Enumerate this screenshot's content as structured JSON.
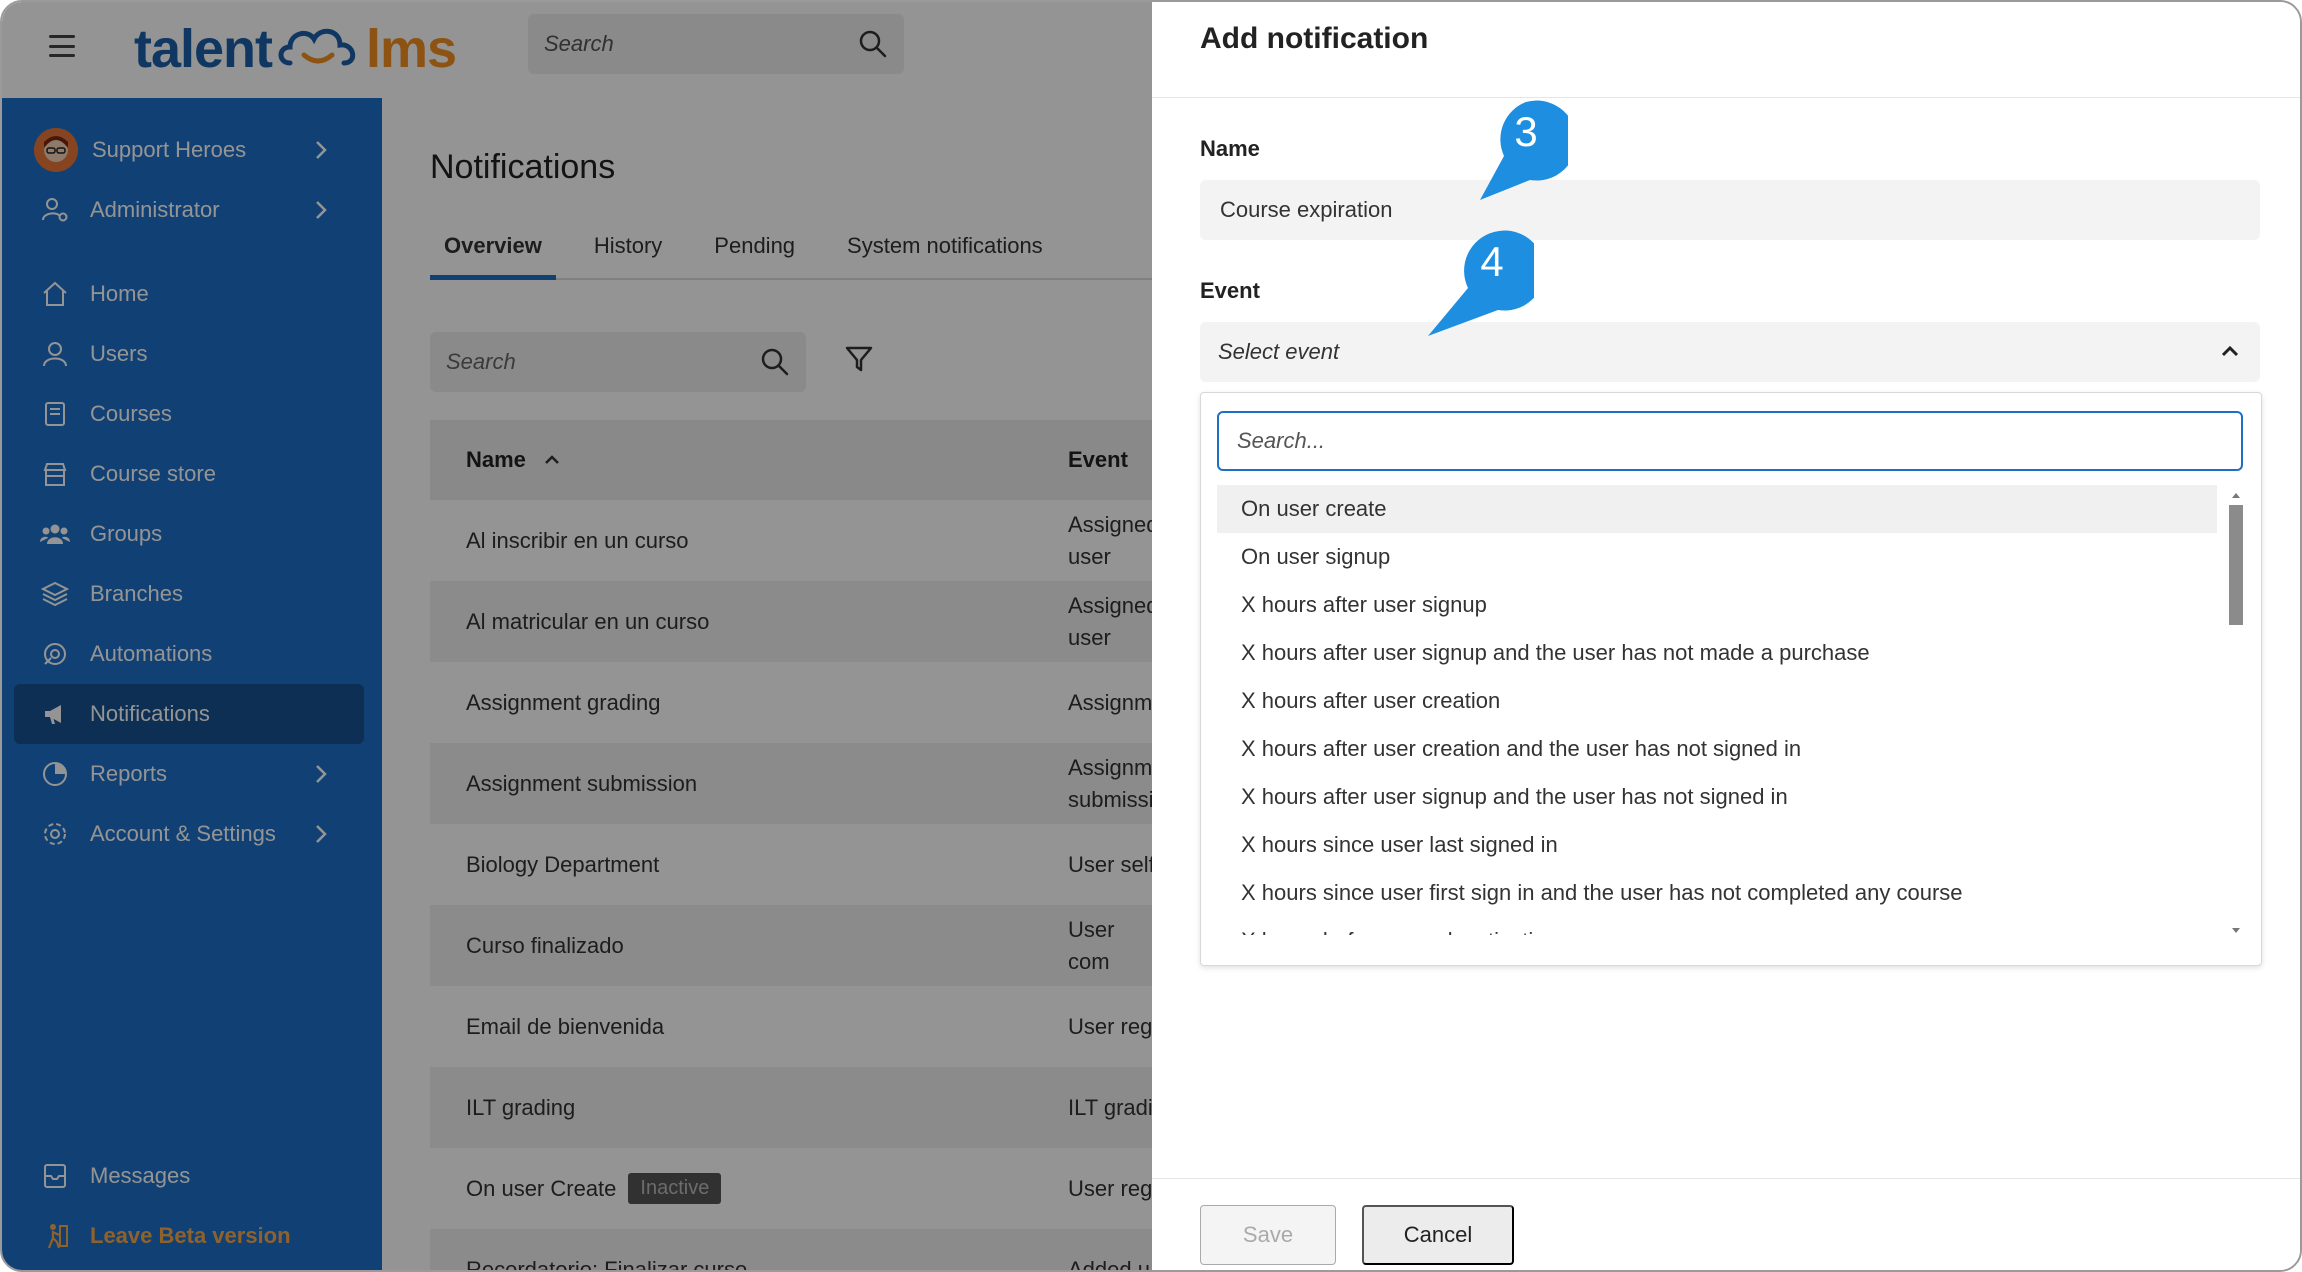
{
  "topbar": {
    "logo_left": "talent",
    "logo_right": "lms",
    "search_placeholder": "Search"
  },
  "sidebar": {
    "account": {
      "label": "Support Heroes"
    },
    "role": {
      "label": "Administrator"
    },
    "items": [
      {
        "label": "Home",
        "icon": "home-icon"
      },
      {
        "label": "Users",
        "icon": "user-icon"
      },
      {
        "label": "Courses",
        "icon": "book-icon"
      },
      {
        "label": "Course store",
        "icon": "store-icon"
      },
      {
        "label": "Groups",
        "icon": "group-icon"
      },
      {
        "label": "Branches",
        "icon": "layers-icon"
      },
      {
        "label": "Automations",
        "icon": "automation-icon"
      },
      {
        "label": "Notifications",
        "icon": "megaphone-icon",
        "active": true
      },
      {
        "label": "Reports",
        "icon": "pie-chart-icon"
      },
      {
        "label": "Account & Settings",
        "icon": "gear-icon"
      }
    ],
    "messages": {
      "label": "Messages"
    },
    "beta": {
      "label": "Leave Beta version"
    }
  },
  "main": {
    "title": "Notifications",
    "tabs": [
      {
        "label": "Overview",
        "active": true
      },
      {
        "label": "History"
      },
      {
        "label": "Pending"
      },
      {
        "label": "System notifications"
      }
    ],
    "search_placeholder": "Search",
    "table": {
      "columns": [
        "Name",
        "Event"
      ],
      "rows": [
        {
          "name": "Al inscribir en un curso",
          "event": "Assigned\nuser"
        },
        {
          "name": "Al matricular en un curso",
          "event": "Assigned\nuser"
        },
        {
          "name": "Assignment grading",
          "event": "Assignm"
        },
        {
          "name": "Assignment submission",
          "event": "Assignm\nsubmissi"
        },
        {
          "name": "Biology Department",
          "event": "User self"
        },
        {
          "name": "Curso finalizado",
          "event": "User com"
        },
        {
          "name": "Email de bienvenida",
          "event": "User reg"
        },
        {
          "name": "ILT grading",
          "event": "ILT gradi"
        },
        {
          "name": "On user Create",
          "event": "User reg",
          "badge": "Inactive"
        },
        {
          "name": "Recordatorio: Finalizar curso",
          "event": "Added u"
        }
      ]
    }
  },
  "drawer": {
    "title": "Add notification",
    "name_label": "Name",
    "name_value": "Course expiration",
    "event_label": "Event",
    "event_placeholder": "Select event",
    "dropdown": {
      "search_placeholder": "Search...",
      "options": [
        "On user create",
        "On user signup",
        "X hours after user signup",
        "X hours after user signup and the user has not made a purchase",
        "X hours after user creation",
        "X hours after user creation and the user has not signed in",
        "X hours after user signup and the user has not signed in",
        "X hours since user last signed in",
        "X hours since user first sign in and the user has not completed any course",
        "X hours before user deactivation"
      ]
    },
    "save_label": "Save",
    "cancel_label": "Cancel"
  },
  "callouts": [
    {
      "number": "3"
    },
    {
      "number": "4"
    }
  ],
  "colors": {
    "sidebar": "#1e70c8",
    "sidebar_active": "#15528f",
    "accent": "#1e6fc6",
    "callout": "#1e8fe0",
    "beta": "#f7a84a"
  }
}
